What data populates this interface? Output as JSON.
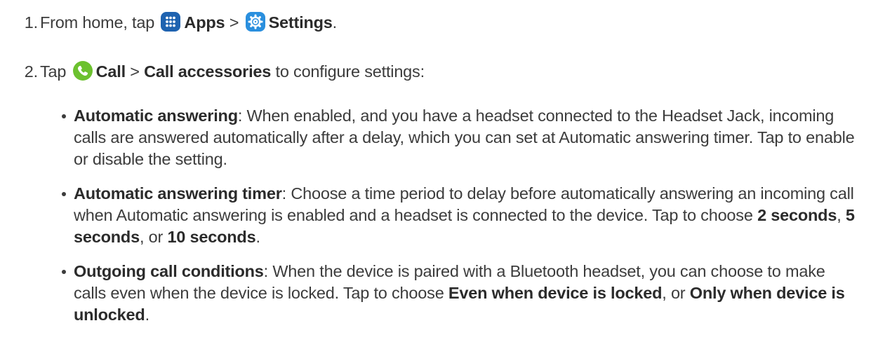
{
  "steps": [
    {
      "number": "1.",
      "prefix": "From home, tap",
      "apps_icon": "apps-grid-icon",
      "apps_label": "Apps",
      "separator": " > ",
      "settings_icon": "settings-gear-icon",
      "settings_label": "Settings",
      "suffix": "."
    },
    {
      "number": "2.",
      "prefix": "Tap",
      "call_icon": "phone-call-icon",
      "call_label": "Call",
      "separator": " > ",
      "accessories_label": "Call accessories",
      "suffix": " to configure settings:"
    }
  ],
  "bullets": [
    {
      "title": "Automatic answering",
      "text": ": When enabled, and you have a headset connected to the Headset Jack, incoming calls are answered automatically after a delay, which you can set at Automatic answering timer. Tap to enable or disable the setting."
    },
    {
      "title": "Automatic answering timer",
      "text": ": Choose a time period to delay before automatically answering an incoming call when Automatic answering is enabled and a headset is connected to the device. Tap to choose ",
      "opt1": "2 seconds",
      "sep1": ", ",
      "opt2": "5 seconds",
      "sep2": ", or ",
      "opt3": "10 seconds",
      "end": "."
    },
    {
      "title": "Outgoing call conditions",
      "text": ": When the device is paired with a Bluetooth headset, you can choose to make calls even when the device is locked. Tap to choose ",
      "opt1": "Even when device is locked",
      "sep1": ", or ",
      "opt2": "Only when device is unlocked",
      "end": "."
    }
  ],
  "colors": {
    "text": "#3c3c3c",
    "apps_icon_bg": "#1f63b0",
    "settings_icon_bg": "#2a8fde",
    "call_icon_bg": "#6cc12f"
  }
}
